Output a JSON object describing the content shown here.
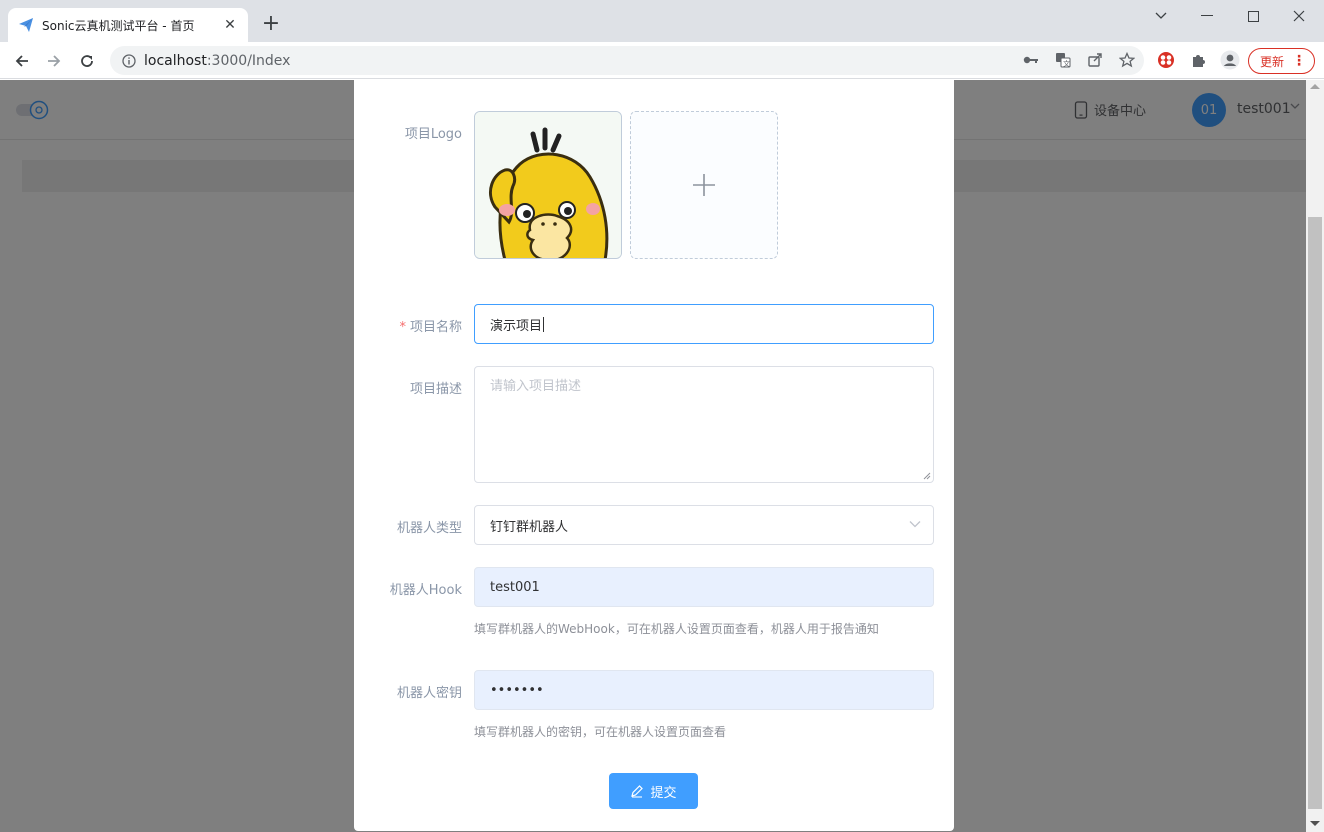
{
  "browser": {
    "tab_title": "Sonic云真机测试平台 - 首页",
    "url_host": "localhost",
    "url_path": ":3000/Index",
    "update_label": "更新"
  },
  "header": {
    "device_center": "设备中心",
    "avatar_text": "01",
    "username": "test001"
  },
  "form": {
    "logo_label": "项目Logo",
    "name_label": "项目名称",
    "name_value": "演示项目",
    "desc_label": "项目描述",
    "desc_placeholder": "请输入项目描述",
    "robot_type_label": "机器人类型",
    "robot_type_value": "钉钉群机器人",
    "hook_label": "机器人Hook",
    "hook_value": "test001",
    "hook_hint": "填写群机器人的WebHook，可在机器人设置页面查看，机器人用于报告通知",
    "secret_label": "机器人密钥",
    "secret_value": "•••••••",
    "secret_hint": "填写群机器人的密钥，可在机器人设置页面查看",
    "submit_label": "提交"
  },
  "colors": {
    "primary": "#409eff",
    "required": "#f56c6c",
    "autofill_bg": "#e8f0fe",
    "update_red": "#d93025"
  }
}
